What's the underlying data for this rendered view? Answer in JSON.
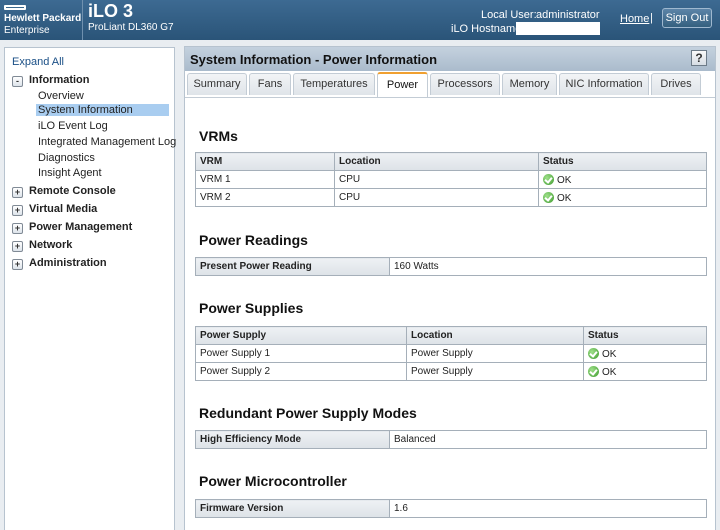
{
  "header": {
    "brand_line1": "Hewlett Packard",
    "brand_line2": "Enterprise",
    "product": "iLO 3",
    "server_model": "ProLiant DL360 G7",
    "local_user_label": "Local User:",
    "local_user": "administrator",
    "hostname_label": "iLO Hostname:",
    "hostname": "",
    "home_link": "Home",
    "separator": "|",
    "signout_label": "Sign Out"
  },
  "nav": {
    "expand_all": "Expand All",
    "information": {
      "label": "Information",
      "toggle": "-"
    },
    "info_children": [
      "Overview",
      "System Information",
      "iLO Event Log",
      "Integrated Management Log",
      "Diagnostics",
      "Insight Agent"
    ],
    "selected": "System Information",
    "groups": [
      {
        "label": "Remote Console",
        "toggle": "+"
      },
      {
        "label": "Virtual Media",
        "toggle": "+"
      },
      {
        "label": "Power Management",
        "toggle": "+"
      },
      {
        "label": "Network",
        "toggle": "+"
      },
      {
        "label": "Administration",
        "toggle": "+"
      }
    ]
  },
  "content": {
    "title": "System Information - Power Information",
    "help": "?",
    "tabs": [
      "Summary",
      "Fans",
      "Temperatures",
      "Power",
      "Processors",
      "Memory",
      "NIC Information",
      "Drives"
    ],
    "active_tab": "Power",
    "vrms": {
      "title": "VRMs",
      "columns": [
        "VRM",
        "Location",
        "Status"
      ],
      "rows": [
        {
          "name": "VRM 1",
          "location": "CPU",
          "status": "OK"
        },
        {
          "name": "VRM 2",
          "location": "CPU",
          "status": "OK"
        }
      ]
    },
    "power_readings": {
      "title": "Power Readings",
      "label": "Present Power Reading",
      "value": "160 Watts"
    },
    "power_supplies": {
      "title": "Power Supplies",
      "columns": [
        "Power Supply",
        "Location",
        "Status"
      ],
      "rows": [
        {
          "name": "Power Supply 1",
          "location": "Power Supply",
          "status": "OK"
        },
        {
          "name": "Power Supply 2",
          "location": "Power Supply",
          "status": "OK"
        }
      ]
    },
    "redundancy": {
      "title": "Redundant Power Supply Modes",
      "label": "High Efficiency Mode",
      "value": "Balanced"
    },
    "microcontroller": {
      "title": "Power Microcontroller",
      "label": "Firmware Version",
      "value": "1.6"
    }
  },
  "colors": {
    "header": "#2f5b82",
    "active_tab_accent": "#f0a030",
    "nav_selected": "#a9cdf0",
    "ok_status": "#3d9a2d"
  }
}
